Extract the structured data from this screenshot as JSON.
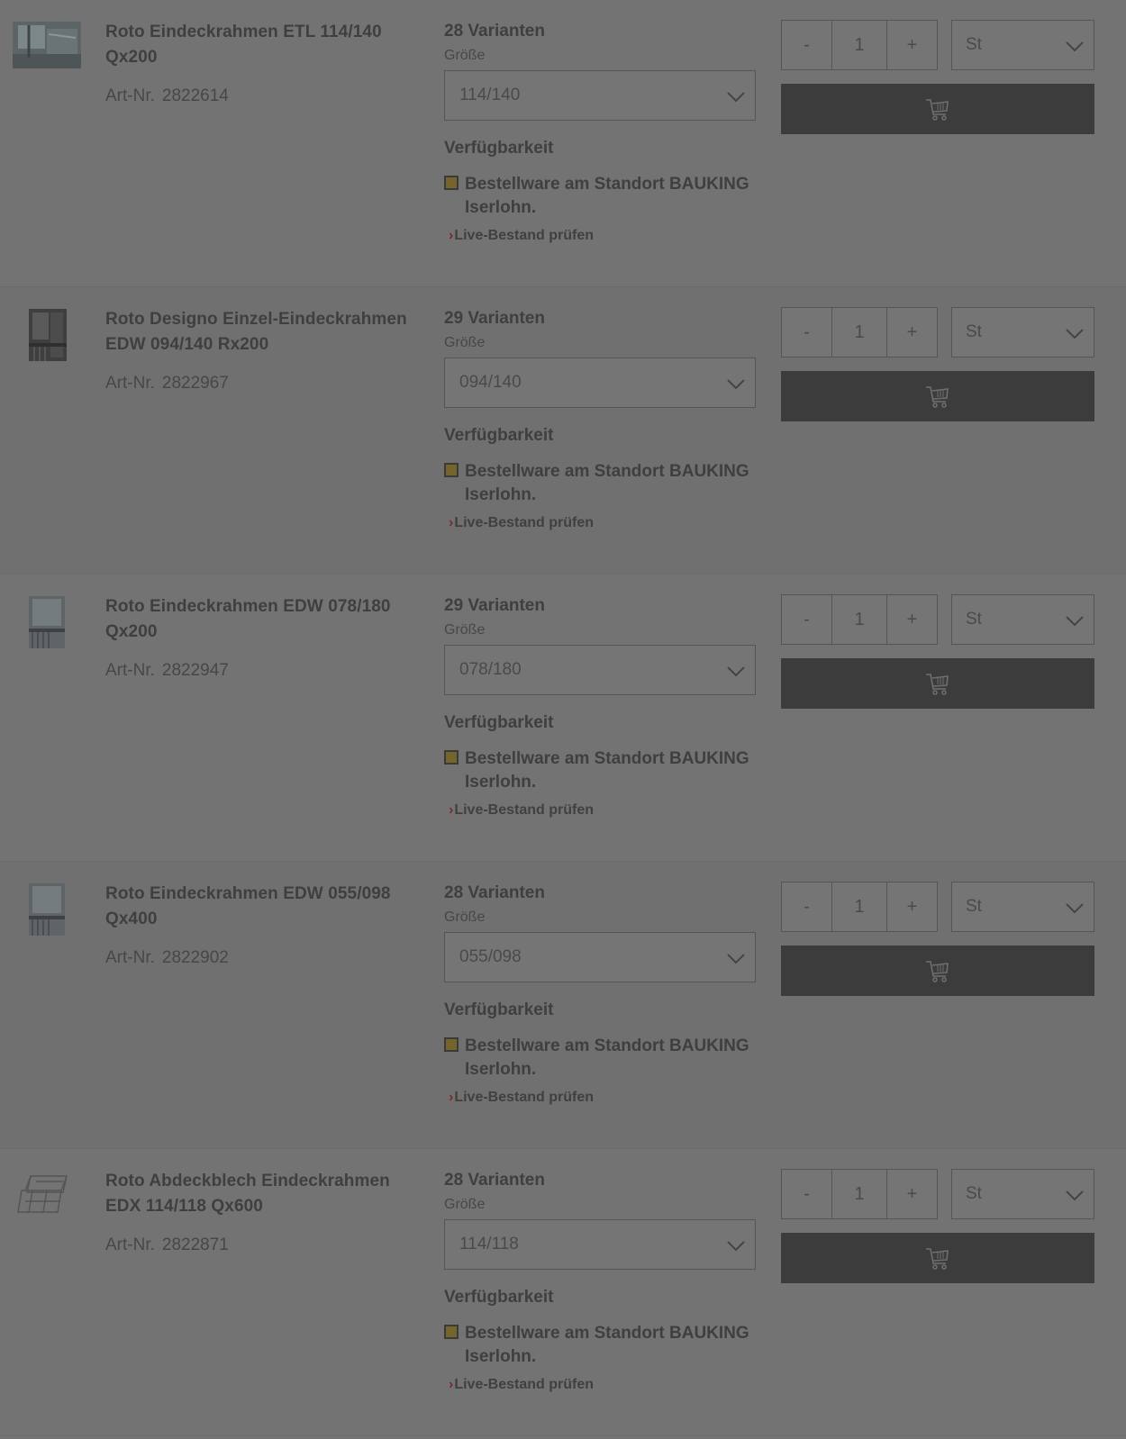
{
  "products": [
    {
      "title": "Roto Eindeckrahmen ETL 114/140 Qx200",
      "art_label": "Art-Nr.",
      "art_number": "2822614",
      "variant_count": "28 Varianten",
      "size_label": "Größe",
      "size_value": "114/140",
      "availability_title": "Verfügbarkeit",
      "availability_text": "Bestellware am Standort BAUKING Iserlohn.",
      "live_link": "Live-Bestand prüfen",
      "quantity": "1",
      "minus": "-",
      "plus": "+",
      "unit": "St",
      "thumb_icon": "window-photo-wide"
    },
    {
      "title": "Roto Designo Einzel-Eindeckrahmen EDW 094/140 Rx200",
      "art_label": "Art-Nr.",
      "art_number": "2822967",
      "variant_count": "29 Varianten",
      "size_label": "Größe",
      "size_value": "094/140",
      "availability_title": "Verfügbarkeit",
      "availability_text": "Bestellware am Standort BAUKING Iserlohn.",
      "live_link": "Live-Bestand prüfen",
      "quantity": "1",
      "minus": "-",
      "plus": "+",
      "unit": "St",
      "thumb_icon": "flashing-photo-dark"
    },
    {
      "title": "Roto Eindeckrahmen EDW 078/180 Qx200",
      "art_label": "Art-Nr.",
      "art_number": "2822947",
      "variant_count": "29 Varianten",
      "size_label": "Größe",
      "size_value": "078/180",
      "availability_title": "Verfügbarkeit",
      "availability_text": "Bestellware am Standort BAUKING Iserlohn.",
      "live_link": "Live-Bestand prüfen",
      "quantity": "1",
      "minus": "-",
      "plus": "+",
      "unit": "St",
      "thumb_icon": "flashing-photo"
    },
    {
      "title": "Roto Eindeckrahmen EDW 055/098 Qx400",
      "art_label": "Art-Nr.",
      "art_number": "2822902",
      "variant_count": "28 Varianten",
      "size_label": "Größe",
      "size_value": "055/098",
      "availability_title": "Verfügbarkeit",
      "availability_text": "Bestellware am Standort BAUKING Iserlohn.",
      "live_link": "Live-Bestand prüfen",
      "quantity": "1",
      "minus": "-",
      "plus": "+",
      "unit": "St",
      "thumb_icon": "flashing-photo"
    },
    {
      "title": "Roto Abdeckblech Eindeckrahmen EDX 114/118 Qx600",
      "art_label": "Art-Nr.",
      "art_number": "2822871",
      "variant_count": "28 Varianten",
      "size_label": "Größe",
      "size_value": "114/118",
      "availability_title": "Verfügbarkeit",
      "availability_text": "Bestellware am Standort BAUKING Iserlohn.",
      "live_link": "Live-Bestand prüfen",
      "quantity": "1",
      "minus": "-",
      "plus": "+",
      "unit": "St",
      "thumb_icon": "sheet-metal-drawing"
    }
  ],
  "colors": {
    "overlay_background": "#737373",
    "cart_button": "#3c3c3c",
    "status_indicator": "#75642b",
    "link_chevron": "#7a2a2a"
  }
}
